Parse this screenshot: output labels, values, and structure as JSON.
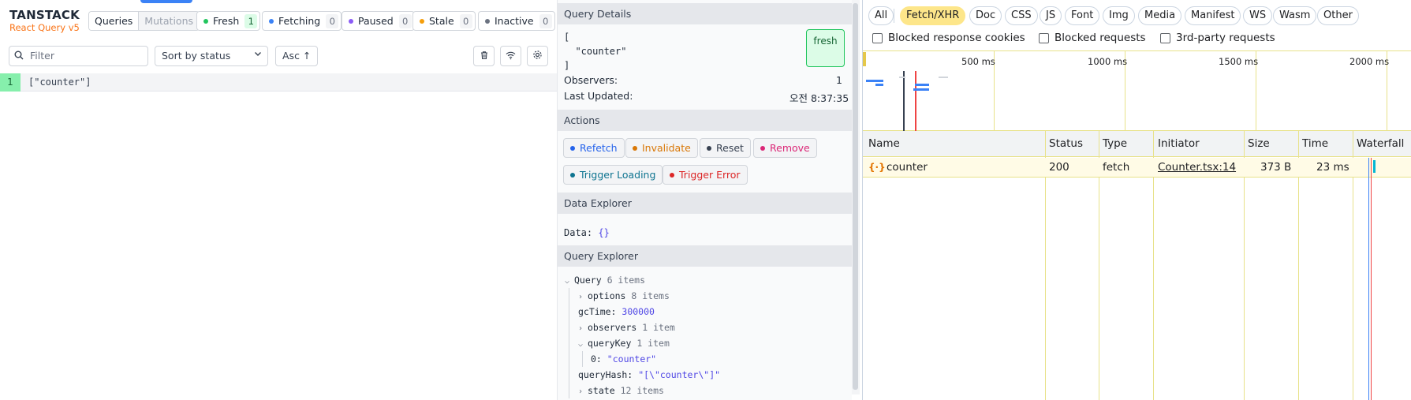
{
  "brand": {
    "name": "TANSTACK",
    "sub": "React Query v5"
  },
  "tabs": {
    "queries": "Queries",
    "mutations": "Mutations"
  },
  "status_chips": [
    {
      "label": "Fresh",
      "count": "1",
      "color": "#22c55e",
      "count_bg": "#dcfce7",
      "count_color": "#166534"
    },
    {
      "label": "Fetching",
      "count": "0",
      "color": "#3b82f6"
    },
    {
      "label": "Paused",
      "count": "0",
      "color": "#8b5cf6"
    },
    {
      "label": "Stale",
      "count": "0",
      "color": "#f59e0b"
    },
    {
      "label": "Inactive",
      "count": "0",
      "color": "#6b7280"
    }
  ],
  "toolbar": {
    "filter_placeholder": "Filter",
    "sort": "Sort by status",
    "order": "Asc ↑"
  },
  "query_list": [
    {
      "index": "1",
      "key": "[\"counter\"]"
    }
  ],
  "details": {
    "title": "Query Details",
    "key_text": "[\n  \"counter\"\n]",
    "status_badge": "fresh",
    "observers_label": "Observers:",
    "observers_value": "1",
    "updated_label": "Last Updated:",
    "updated_value": "오전 8:37:35"
  },
  "actions": {
    "title": "Actions",
    "buttons": [
      {
        "label": "Refetch",
        "color": "#2563eb"
      },
      {
        "label": "Invalidate",
        "color": "#d97706"
      },
      {
        "label": "Reset",
        "color": "#374151"
      },
      {
        "label": "Remove",
        "color": "#db2777"
      },
      {
        "label": "Trigger Loading",
        "color": "#0e7490"
      },
      {
        "label": "Trigger Error",
        "color": "#dc2626"
      }
    ]
  },
  "data_explorer": {
    "title": "Data Explorer",
    "label": "Data:",
    "value": "{}"
  },
  "query_explorer": {
    "title": "Query Explorer",
    "root": {
      "key": "Query",
      "meta": "6 items"
    },
    "options": {
      "key": "options",
      "meta": "8 items"
    },
    "gcTime": {
      "key": "gcTime:",
      "value": "300000"
    },
    "observers": {
      "key": "observers",
      "meta": "1 item"
    },
    "queryKey": {
      "key": "queryKey",
      "meta": "1 item"
    },
    "queryKey0": {
      "key": "0:",
      "value": "\"counter\""
    },
    "queryHash": {
      "key": "queryHash:",
      "value": "\"[\\\"counter\\\"]\""
    },
    "state": {
      "key": "state",
      "meta": "12 items"
    }
  },
  "network": {
    "filters": [
      "All",
      "Fetch/XHR",
      "Doc",
      "CSS",
      "JS",
      "Font",
      "Img",
      "Media",
      "Manifest",
      "WS",
      "Wasm",
      "Other"
    ],
    "checkboxes": [
      "Blocked response cookies",
      "Blocked requests",
      "3rd-party requests"
    ],
    "timeline_labels": [
      "500 ms",
      "1000 ms",
      "1500 ms",
      "2000 ms"
    ],
    "columns": [
      "Name",
      "Status",
      "Type",
      "Initiator",
      "Size",
      "Time",
      "Waterfall"
    ],
    "rows": [
      {
        "name": "counter",
        "status": "200",
        "type": "fetch",
        "initiator": "Counter.tsx:14",
        "size": "373 B",
        "time": "23 ms"
      }
    ]
  }
}
